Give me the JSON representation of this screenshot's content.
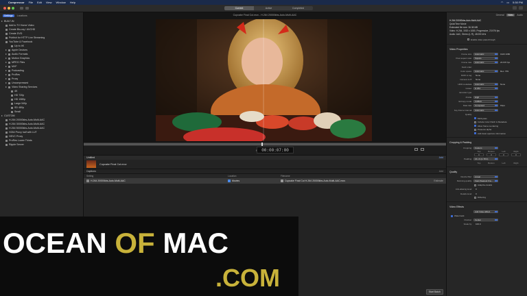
{
  "menubar": {
    "app": "Compressor",
    "items": [
      "File",
      "Edit",
      "View",
      "Window",
      "Help"
    ],
    "clock": "5:30 PM"
  },
  "toolbar": {
    "segments": [
      {
        "label": "Current",
        "active": true
      },
      {
        "label": "Active",
        "active": false
      },
      {
        "label": "Completed",
        "active": false
      }
    ],
    "zoom": "38%"
  },
  "sidebar": {
    "tabs": [
      {
        "label": "Settings",
        "active": true
      },
      {
        "label": "Locations",
        "active": false
      }
    ],
    "items": [
      {
        "label": "BUILT-IN",
        "kind": "header"
      },
      {
        "label": "Add to TV Home Video",
        "kind": "item"
      },
      {
        "label": "Create Blu-ray / AVCHD",
        "kind": "item"
      },
      {
        "label": "Create DVD",
        "kind": "item"
      },
      {
        "label": "Publish for HTTP Live Streaming",
        "kind": "item"
      },
      {
        "label": "YouTube & Facebook",
        "kind": "item"
      },
      {
        "label": "Up to 4K",
        "kind": "sub"
      },
      {
        "label": "Apple Devices",
        "kind": "group"
      },
      {
        "label": "Audio Formats",
        "kind": "group"
      },
      {
        "label": "Motion Graphics",
        "kind": "group"
      },
      {
        "label": "MPEG Files",
        "kind": "group"
      },
      {
        "label": "MXF",
        "kind": "group"
      },
      {
        "label": "Podcasting",
        "kind": "group"
      },
      {
        "label": "ProRes",
        "kind": "group"
      },
      {
        "label": "Proxy",
        "kind": "group"
      },
      {
        "label": "Uncompressed",
        "kind": "group"
      },
      {
        "label": "Video Sharing Services",
        "kind": "group"
      },
      {
        "label": "4K",
        "kind": "sub"
      },
      {
        "label": "HD 720p",
        "kind": "sub"
      },
      {
        "label": "HD 1080p",
        "kind": "sub"
      },
      {
        "label": "Large 540p",
        "kind": "sub"
      },
      {
        "label": "SD 480p",
        "kind": "sub"
      },
      {
        "label": "Small",
        "kind": "sub"
      },
      {
        "label": "CUSTOM",
        "kind": "header"
      },
      {
        "label": "H.264 20000kbs-Auto-Multi-AAC",
        "kind": "item"
      },
      {
        "label": "H.264 30000kbs-Auto-Multi-AAC",
        "kind": "item"
      },
      {
        "label": "H.264 50000kbs-Auto-Multi-AAC",
        "kind": "item"
      },
      {
        "label": "H264 Proxy half with LUT",
        "kind": "item"
      },
      {
        "label": "HEVC Proxy",
        "kind": "item"
      },
      {
        "label": "ProRes Lower Thirds",
        "kind": "item"
      },
      {
        "label": "Ripple Server",
        "kind": "item"
      }
    ]
  },
  "viewer": {
    "file_title": "Cupcake Final Cut.mov - H.264 20000kbs-Auto-Multi-AAC",
    "timecode": "00:00:07:00",
    "playhead": 0.49
  },
  "batch": {
    "header": "Untitled",
    "header_action": "Add",
    "job_name": "Cupcake Final Cut.mov",
    "captions_label": "Captions",
    "captions_action": "Add",
    "columns": [
      "Setting",
      "Location",
      "Filename"
    ],
    "output": {
      "setting": "H.264 20000kbs-Auto-Multi-AAC",
      "location": "Movies",
      "filename": "Cupcake Final Cut H.264 20000kbs-Auto-Multi-AAC.mov",
      "size": "Estimate"
    },
    "start_label": "Start Batch"
  },
  "inspector": {
    "tabs": [
      {
        "label": "General",
        "active": false
      },
      {
        "label": "Video",
        "active": true
      },
      {
        "label": "Audio",
        "active": false
      }
    ],
    "summary_title": "H.264 20000kbs-Auto-Multi-AAC",
    "summary_lines": [
      "QuickTime Movie",
      "Estimated file size: 36.38 MB",
      "Video: H.264, 1920 x 1080, Progressive, 23.976 fps",
      "Audio: AAC, Stereo (L R), 48.000 kHz"
    ],
    "passthrough": "Enable video pass-through",
    "video_props_title": "Video Properties",
    "props": [
      {
        "label": "Frame size:",
        "value": "Automatic",
        "extra": "1920   1080"
      },
      {
        "label": "Pixel aspect ratio:",
        "value": "Square",
        "extra": ""
      },
      {
        "label": "Frame rate:",
        "value": "Automatic",
        "extra": "23.976  fps"
      },
      {
        "label": "Field order:",
        "value": "",
        "extra": ""
      },
      {
        "label": "Color space:",
        "value": "Automatic",
        "extra": "Rec. 709"
      },
      {
        "label": "RAW to log:",
        "value": "",
        "extra": "None"
      },
      {
        "label": "Camera LUT:",
        "value": "",
        "extra": "None"
      },
      {
        "label": "HDR metadata:",
        "value": "Automatic",
        "extra": "None"
      },
      {
        "label": "Codec:",
        "value": "H.264",
        "extra": ""
      },
      {
        "label": "Encoder type:",
        "value": "",
        "extra": ""
      },
      {
        "label": "Profile:",
        "value": "High",
        "extra": ""
      },
      {
        "label": "Entropy mode:",
        "value": "CABAC",
        "extra": ""
      },
      {
        "label": "Data rate:",
        "value": "Computed",
        "extra": "Kbps"
      },
      {
        "label": "Key Frame Interval:",
        "value": "Automatic",
        "extra": ""
      },
      {
        "label": "Quality:",
        "value": "",
        "extra": ""
      }
    ],
    "checks": [
      {
        "label": "Multi-pass",
        "on": true
      },
      {
        "label": "Include Color Patch & Metadata",
        "on": false
      },
      {
        "label": "Allow frame reordering",
        "on": true
      },
      {
        "label": "Preserve alpha",
        "on": false
      },
      {
        "label": "Add clean aperture information",
        "on": true
      }
    ],
    "crop_title": "Cropping & Padding",
    "crop": {
      "label": "Cropping:",
      "value": "Custom"
    },
    "padding": {
      "label": "Padding:",
      "value": "16 x 9 (1.78:1)"
    },
    "edges": [
      "Top",
      "Bottom",
      "Left",
      "Right"
    ],
    "crop_values": [
      "0",
      "0",
      "0",
      "0"
    ],
    "quality_title": "Quality",
    "quality": [
      {
        "label": "Resize filter:",
        "value": "Linear"
      },
      {
        "label": "Retiming quality:",
        "value": "Fast (Nearest Fra..."
      }
    ],
    "adaptive": "Adaptive details",
    "quality2": [
      {
        "label": "Anti-aliasing level:",
        "value": "0"
      },
      {
        "label": "Details level:",
        "value": "0"
      }
    ],
    "dithering": "Dithering",
    "effects_title": "Video Effects",
    "effects_add": "Add Video Effect",
    "watermark_item": "Watermark",
    "position": {
      "label": "Position:",
      "value": "Center"
    },
    "scale": {
      "label": "Scale by:",
      "value": "100.0"
    }
  },
  "watermark": {
    "ocean": "OCEAN",
    "of": "OF",
    "mac": "MAC",
    "com": ".COM"
  },
  "colors": {
    "accent": "#3c6ad1",
    "watermark_gold": "#c8b23a"
  }
}
